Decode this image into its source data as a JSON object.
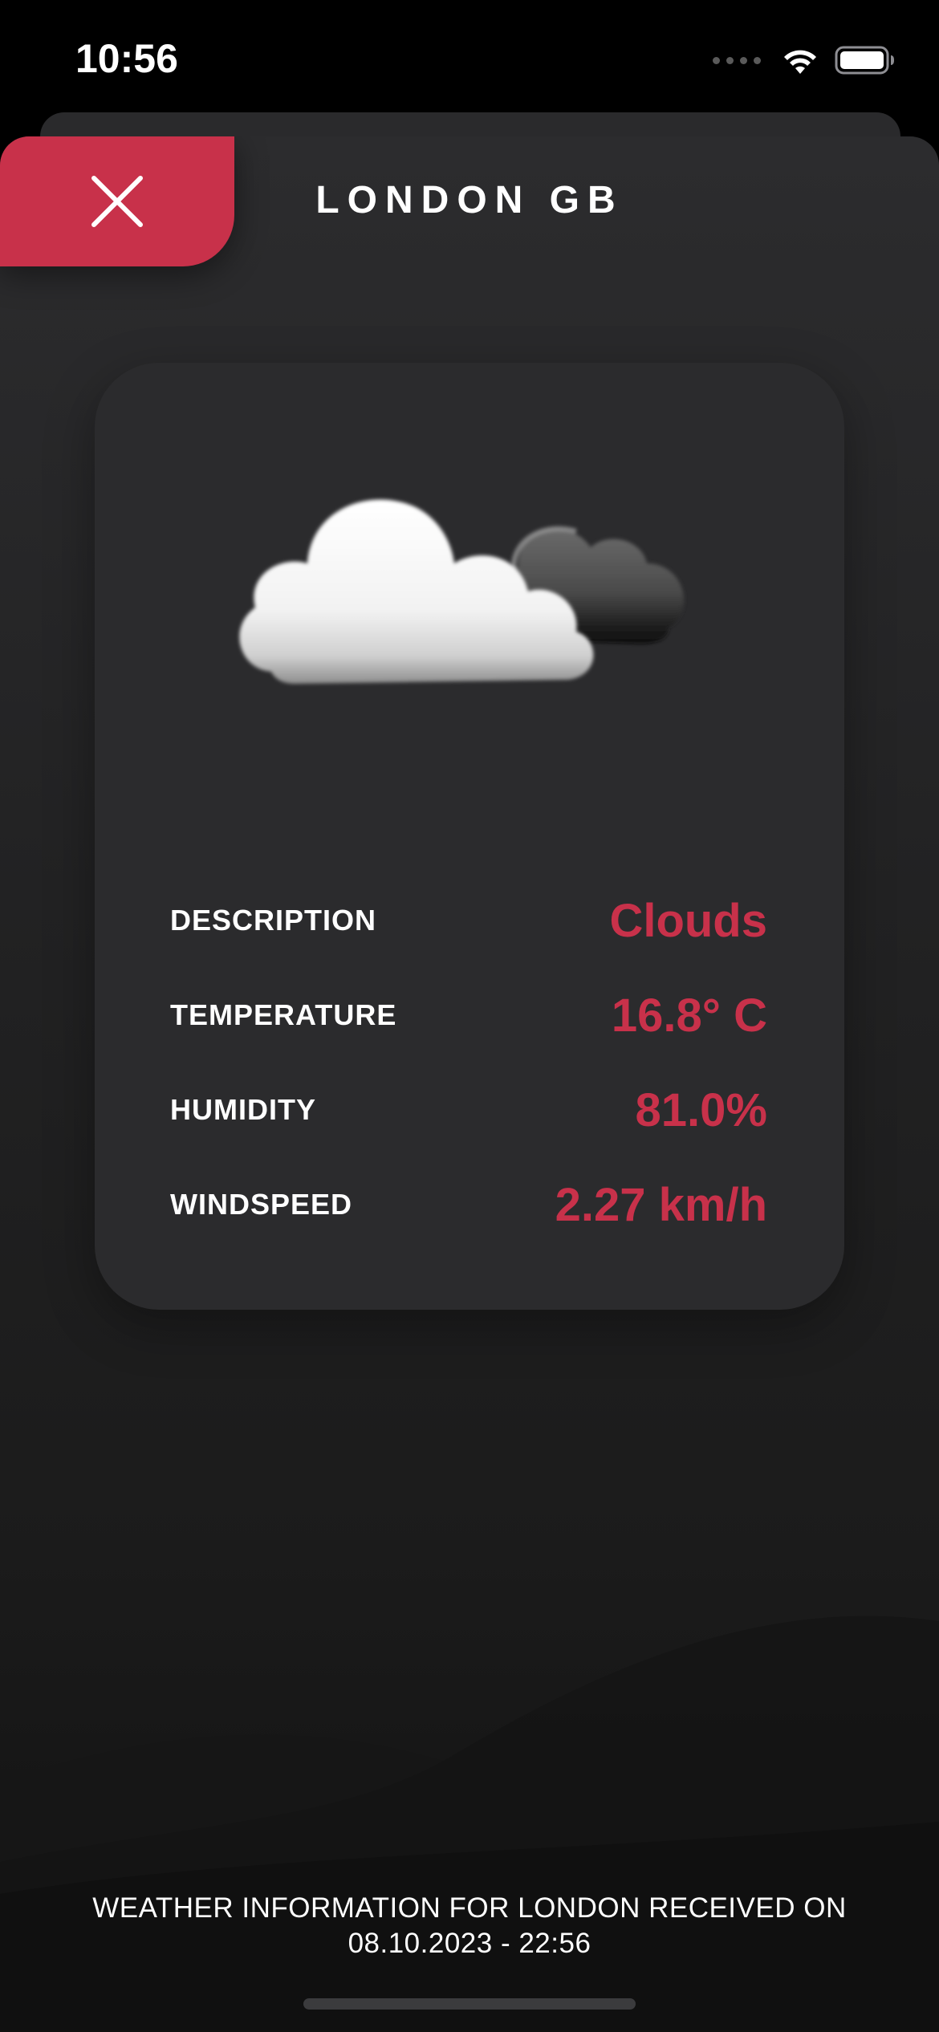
{
  "status_bar": {
    "time": "10:56",
    "icons": [
      "cellular-signal-icon",
      "wifi-icon",
      "battery-icon"
    ]
  },
  "header": {
    "close_icon": "close-icon",
    "title": "LONDON GB"
  },
  "weather": {
    "icon": "clouds-icon",
    "rows": [
      {
        "label": "DESCRIPTION",
        "value": "Clouds"
      },
      {
        "label": "TEMPERATURE",
        "value": "16.8° C"
      },
      {
        "label": "HUMIDITY",
        "value": "81.0%"
      },
      {
        "label": "WINDSPEED",
        "value": "2.27 km/h"
      }
    ]
  },
  "footer": {
    "line1": "WEATHER INFORMATION FOR LONDON RECEIVED ON",
    "line2": "08.10.2023 - 22:56"
  },
  "colors": {
    "accent": "#c8314a",
    "card": "#2b2b2d",
    "background": "#1b1b1b",
    "text": "#ffffff"
  }
}
